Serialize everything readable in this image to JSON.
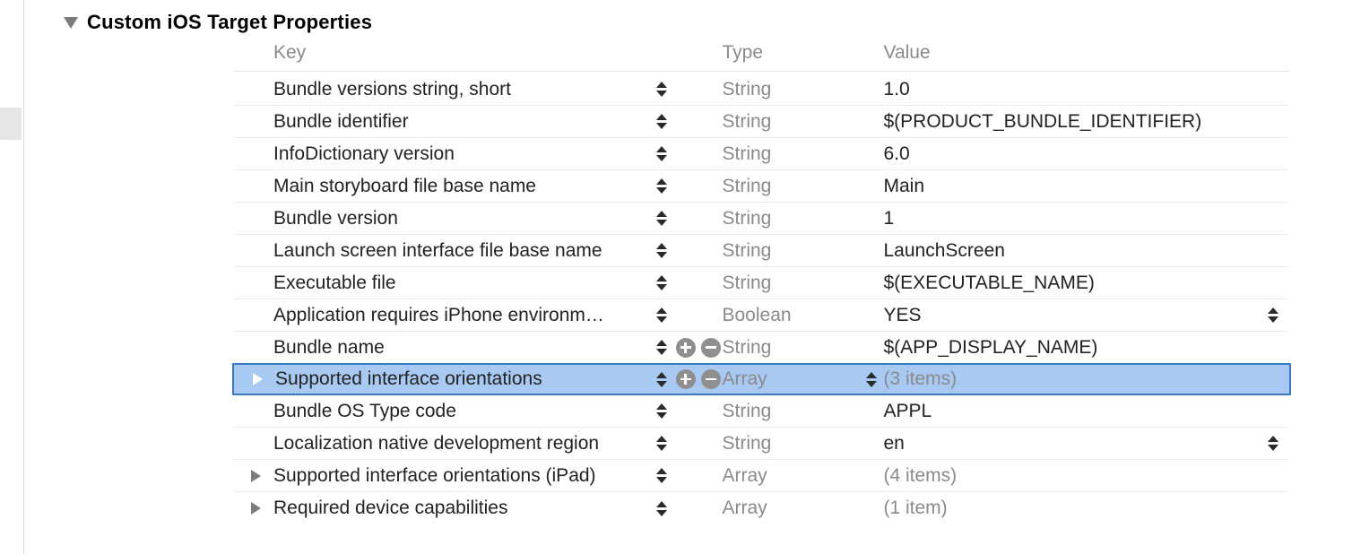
{
  "section": {
    "title": "Custom iOS Target Properties"
  },
  "columns": {
    "key": "Key",
    "type": "Type",
    "value": "Value"
  },
  "rows": [
    {
      "key": "Bundle versions string, short",
      "type": "String",
      "value": "1.0",
      "disclosure": "none",
      "showAddRemove": false,
      "selected": false,
      "typeStepper": false,
      "trailStepper": false,
      "valueMuted": false
    },
    {
      "key": "Bundle identifier",
      "type": "String",
      "value": "$(PRODUCT_BUNDLE_IDENTIFIER)",
      "disclosure": "none",
      "showAddRemove": false,
      "selected": false,
      "typeStepper": false,
      "trailStepper": false,
      "valueMuted": false
    },
    {
      "key": "InfoDictionary version",
      "type": "String",
      "value": "6.0",
      "disclosure": "none",
      "showAddRemove": false,
      "selected": false,
      "typeStepper": false,
      "trailStepper": false,
      "valueMuted": false
    },
    {
      "key": "Main storyboard file base name",
      "type": "String",
      "value": "Main",
      "disclosure": "none",
      "showAddRemove": false,
      "selected": false,
      "typeStepper": false,
      "trailStepper": false,
      "valueMuted": false
    },
    {
      "key": "Bundle version",
      "type": "String",
      "value": "1",
      "disclosure": "none",
      "showAddRemove": false,
      "selected": false,
      "typeStepper": false,
      "trailStepper": false,
      "valueMuted": false
    },
    {
      "key": "Launch screen interface file base name",
      "type": "String",
      "value": "LaunchScreen",
      "disclosure": "none",
      "showAddRemove": false,
      "selected": false,
      "typeStepper": false,
      "trailStepper": false,
      "valueMuted": false
    },
    {
      "key": "Executable file",
      "type": "String",
      "value": "$(EXECUTABLE_NAME)",
      "disclosure": "none",
      "showAddRemove": false,
      "selected": false,
      "typeStepper": false,
      "trailStepper": false,
      "valueMuted": false
    },
    {
      "key": "Application requires iPhone environm…",
      "type": "Boolean",
      "value": "YES",
      "disclosure": "none",
      "showAddRemove": false,
      "selected": false,
      "typeStepper": false,
      "trailStepper": true,
      "valueMuted": false
    },
    {
      "key": "Bundle name",
      "type": "String",
      "value": "$(APP_DISPLAY_NAME)",
      "disclosure": "none",
      "showAddRemove": true,
      "selected": false,
      "typeStepper": false,
      "trailStepper": false,
      "valueMuted": false
    },
    {
      "key": "Supported interface orientations",
      "type": "Array",
      "value": "(3 items)",
      "disclosure": "right-white",
      "showAddRemove": true,
      "selected": true,
      "typeStepper": true,
      "trailStepper": false,
      "valueMuted": true
    },
    {
      "key": "Bundle OS Type code",
      "type": "String",
      "value": "APPL",
      "disclosure": "none",
      "showAddRemove": false,
      "selected": false,
      "typeStepper": false,
      "trailStepper": false,
      "valueMuted": false
    },
    {
      "key": "Localization native development region",
      "type": "String",
      "value": "en",
      "disclosure": "none",
      "showAddRemove": false,
      "selected": false,
      "typeStepper": false,
      "trailStepper": true,
      "valueMuted": false
    },
    {
      "key": "Supported interface orientations (iPad)",
      "type": "Array",
      "value": "(4 items)",
      "disclosure": "right",
      "showAddRemove": false,
      "selected": false,
      "typeStepper": false,
      "trailStepper": false,
      "valueMuted": true
    },
    {
      "key": "Required device capabilities",
      "type": "Array",
      "value": "(1 item)",
      "disclosure": "right",
      "showAddRemove": false,
      "selected": false,
      "typeStepper": false,
      "trailStepper": false,
      "valueMuted": true
    }
  ]
}
